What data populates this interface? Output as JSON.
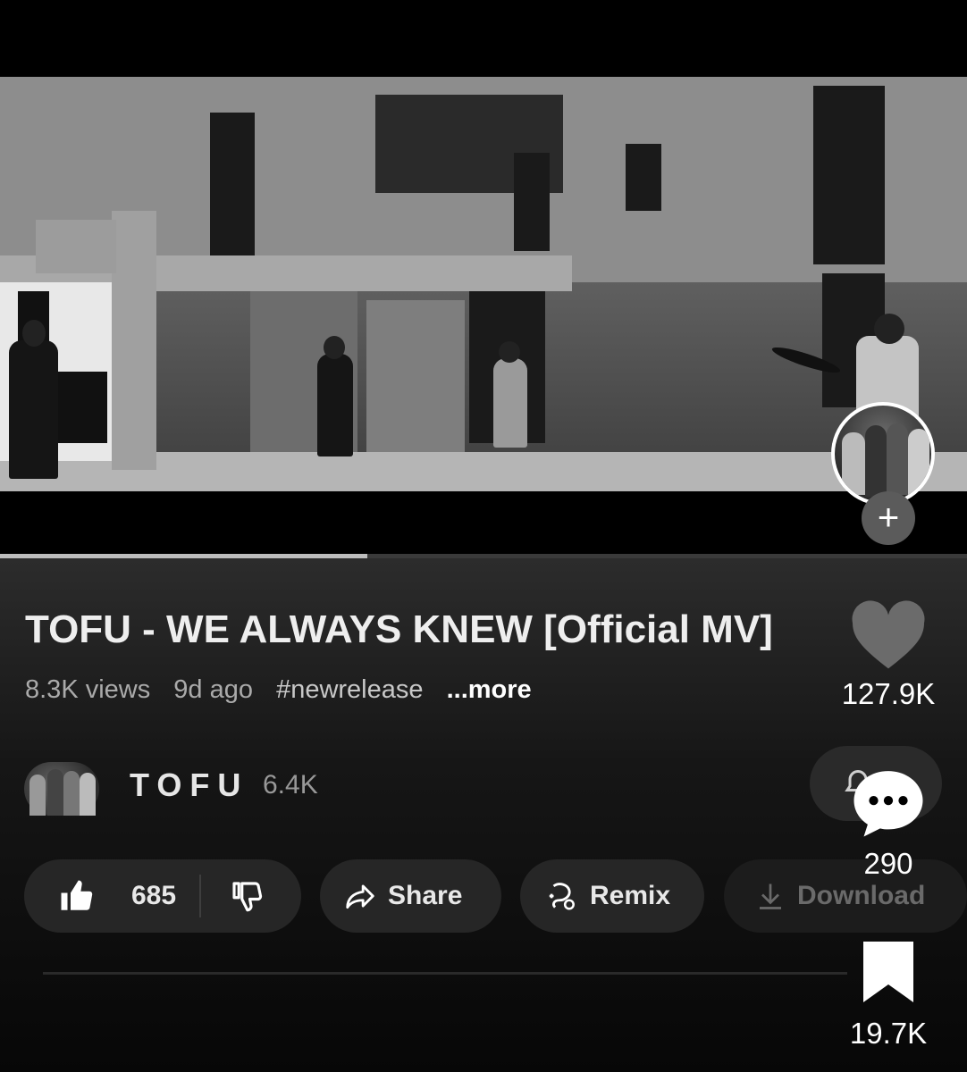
{
  "video": {
    "progress_fraction": 0.38
  },
  "creator": {
    "follow_label": "+"
  },
  "info": {
    "title": "TOFU - WE ALWAYS KNEW [Official MV]",
    "views": "8.3K views",
    "age": "9d ago",
    "hashtag": "#newrelease",
    "more": "...more"
  },
  "channel": {
    "name": "TOFU",
    "subscribers": "6.4K"
  },
  "actions": {
    "like_count": "685",
    "share_label": "Share",
    "remix_label": "Remix",
    "download_label": "Download"
  },
  "rail": {
    "likes": "127.9K",
    "comments": "290",
    "saves": "19.7K"
  },
  "icons": {
    "heart": "heart-icon",
    "comment": "comment-bubble-icon",
    "bookmark": "bookmark-icon",
    "thumbs_up": "thumbs-up-icon",
    "thumbs_down": "thumbs-down-icon",
    "share": "share-arrow-icon",
    "remix": "remix-icon",
    "download": "download-icon",
    "bell": "bell-icon"
  },
  "colors": {
    "background": "#000000",
    "panel": "#161616",
    "heart": "#6b6b6b"
  }
}
